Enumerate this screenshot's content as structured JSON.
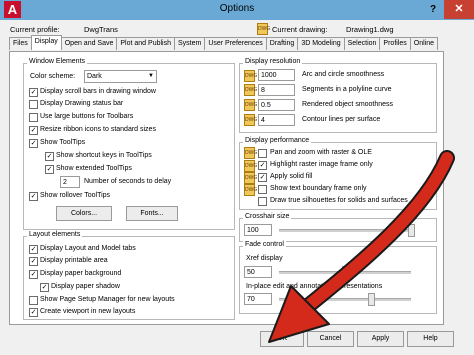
{
  "window": {
    "title": "Options",
    "help": "?",
    "close": "✕",
    "app_icon": "A"
  },
  "header": {
    "current_profile_label": "Current profile:",
    "current_profile": "DwgTrans",
    "current_drawing_label": "Current drawing:",
    "current_drawing": "Drawing1.dwg"
  },
  "tabs": [
    "Files",
    "Display",
    "Open and Save",
    "Plot and Publish",
    "System",
    "User Preferences",
    "Drafting",
    "3D Modeling",
    "Selection",
    "Profiles",
    "Online"
  ],
  "active_tab": "Display",
  "window_elements": {
    "title": "Window Elements",
    "color_scheme_label": "Color scheme:",
    "color_scheme": "Dark",
    "checks": [
      {
        "label": "Display scroll bars in drawing window",
        "checked": true
      },
      {
        "label": "Display Drawing status bar",
        "checked": false
      },
      {
        "label": "Use large buttons for Toolbars",
        "checked": false
      },
      {
        "label": "Resize ribbon icons to standard sizes",
        "checked": true
      },
      {
        "label": "Show ToolTips",
        "checked": true
      },
      {
        "label": "Show shortcut keys in ToolTips",
        "checked": true
      },
      {
        "label": "Show extended ToolTips",
        "checked": true
      },
      {
        "label": "Show rollover ToolTips",
        "checked": true
      }
    ],
    "delay_value": "2",
    "delay_label": "Number of seconds to delay",
    "colors_button": "Colors...",
    "fonts_button": "Fonts..."
  },
  "layout_elements": {
    "title": "Layout elements",
    "checks": [
      {
        "label": "Display Layout and Model tabs",
        "checked": true
      },
      {
        "label": "Display printable area",
        "checked": true
      },
      {
        "label": "Display paper background",
        "checked": true
      },
      {
        "label": "Display paper shadow",
        "checked": true
      },
      {
        "label": "Show Page Setup Manager for new layouts",
        "checked": false
      },
      {
        "label": "Create viewport in new layouts",
        "checked": true
      }
    ]
  },
  "display_resolution": {
    "title": "Display resolution",
    "rows": [
      {
        "value": "1000",
        "label": "Arc and circle smoothness"
      },
      {
        "value": "8",
        "label": "Segments in a polyline curve"
      },
      {
        "value": "0.5",
        "label": "Rendered object smoothness"
      },
      {
        "value": "4",
        "label": "Contour lines per surface"
      }
    ]
  },
  "display_performance": {
    "title": "Display performance",
    "rows": [
      {
        "label": "Pan and zoom with raster & OLE",
        "checked": false
      },
      {
        "label": "Highlight raster image frame only",
        "checked": true
      },
      {
        "label": "Apply solid fill",
        "checked": true
      },
      {
        "label": "Show text boundary frame only",
        "checked": false
      },
      {
        "label": "Draw true silhouettes for solids and surfaces",
        "checked": false
      }
    ]
  },
  "crosshair": {
    "title": "Crosshair size",
    "value": "100",
    "level": 1.0
  },
  "fade_control": {
    "title": "Fade control",
    "xref_label": "Xref display",
    "xref_value": "50",
    "xref_level": 0.5,
    "inplace_label": "In-place edit and annotative representations",
    "inplace_value": "70",
    "inplace_level": 0.7
  },
  "buttons": {
    "ok": "OK",
    "cancel": "Cancel",
    "apply": "Apply",
    "help": "Help"
  },
  "colors": {
    "titlebar": "#6aa9d6",
    "close": "#c64132",
    "arrow": "#d42a1c",
    "dialog": "#f0f0f0"
  }
}
